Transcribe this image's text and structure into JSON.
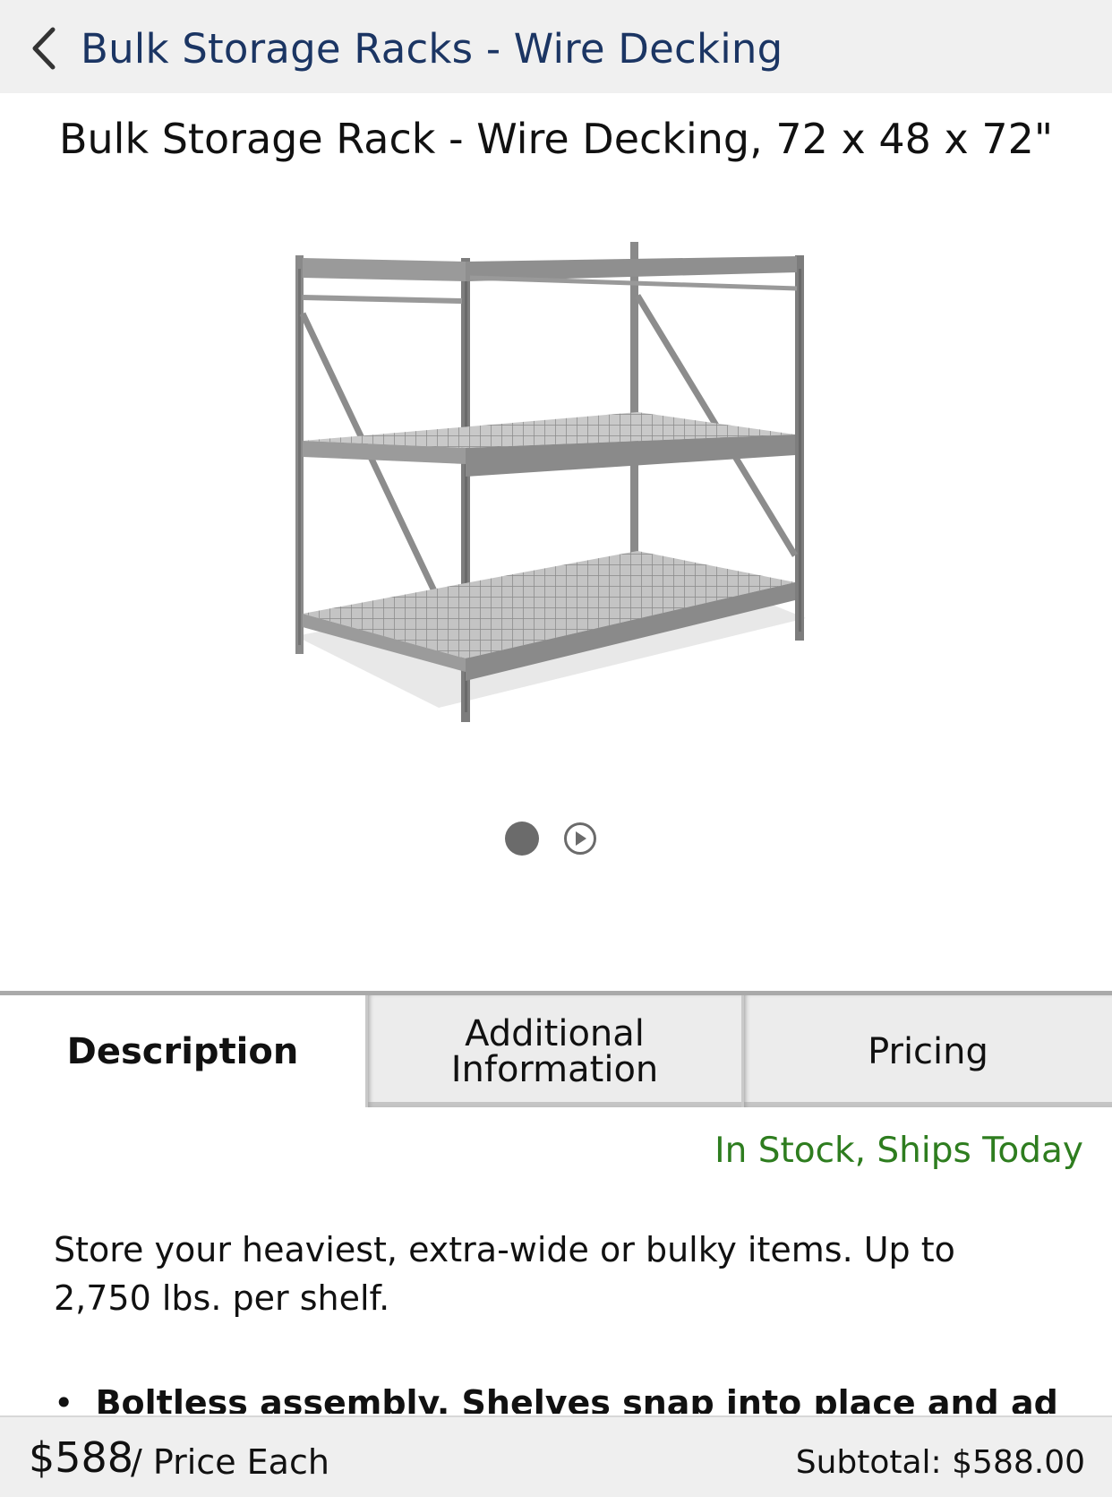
{
  "header": {
    "back_icon": "chevron-left-icon",
    "title": "Bulk Storage Racks - Wire Decking"
  },
  "product": {
    "title": "Bulk Storage Rack - Wire Decking, 72 x 48 x 72\"",
    "image_icon": "shelving-rack-image"
  },
  "carousel": {
    "dot_icon": "dot-indicator",
    "video_icon": "play-icon"
  },
  "tabs": [
    {
      "label": "Description",
      "active": true
    },
    {
      "label": "Additional Information",
      "active": false
    },
    {
      "label": "Pricing",
      "active": false
    }
  ],
  "stock_status": "In Stock, Ships Today",
  "description": "Store your heaviest, extra-wide or bulky items. Up to 2,750 lbs. per shelf.",
  "bullet_partial": "Boltless assembly. Shelves snap into place and adjust at",
  "footer": {
    "price": "$588",
    "price_unit": "/ Price Each",
    "subtotal": "Subtotal: $588.00"
  },
  "colors": {
    "nav_title": "#1b3563",
    "stock_status": "#2e7d1f",
    "nav_bg": "#f0f0f0"
  }
}
